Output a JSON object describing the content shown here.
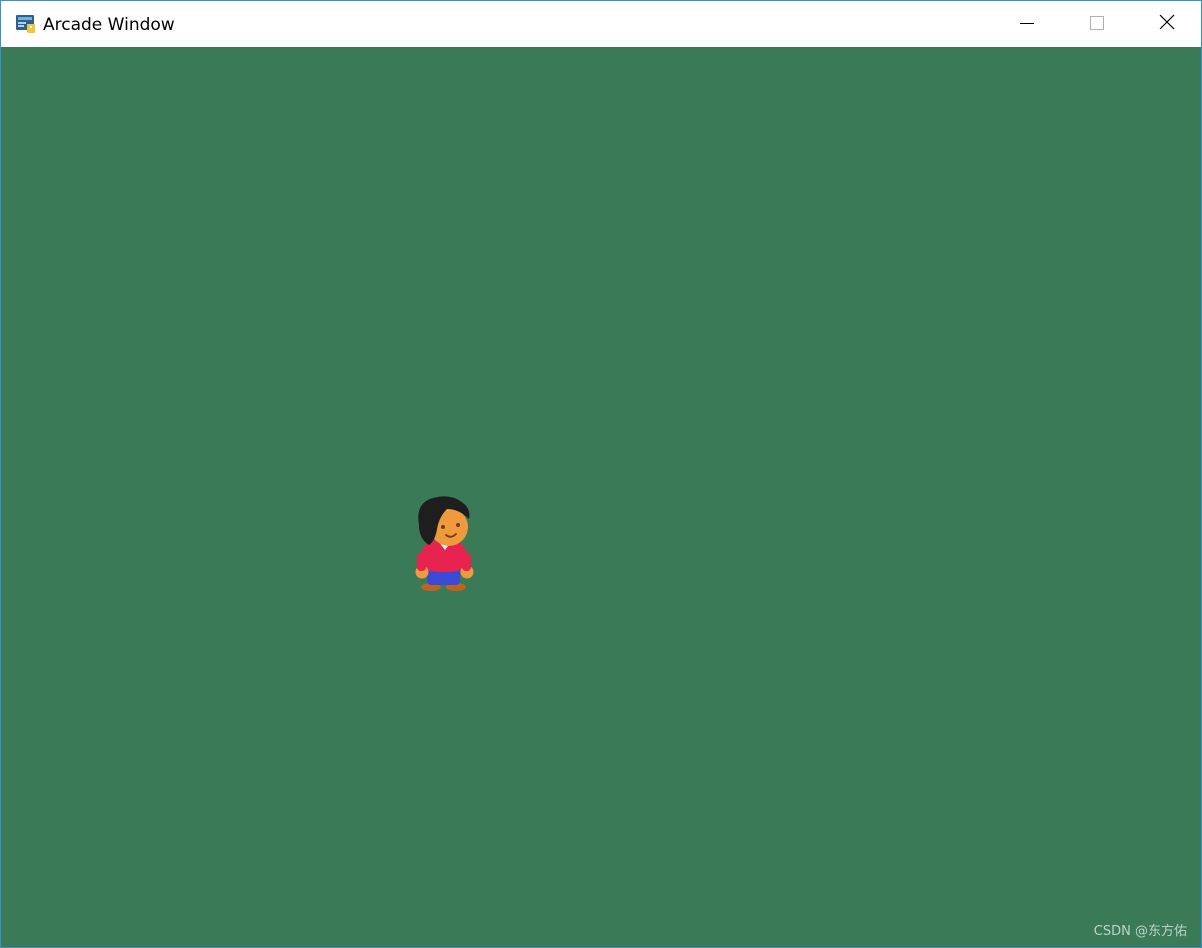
{
  "window": {
    "title": "Arcade Window",
    "app_icon": "python-arcade-icon",
    "controls": {
      "minimize": "minimize-icon",
      "maximize": "maximize-icon",
      "close": "close-icon"
    }
  },
  "canvas": {
    "background_color": "#3b7a57",
    "sprite": "player-character-sprite"
  },
  "watermark": "CSDN @东方佑",
  "colors": {
    "titlebar": "#ffffff",
    "window_border": "#3c8fd0",
    "shirt": "#e8234f",
    "skin": "#f09a3e",
    "hair": "#1e1e1e",
    "pants": "#3a4ad6",
    "shoes": "#c0631f"
  }
}
